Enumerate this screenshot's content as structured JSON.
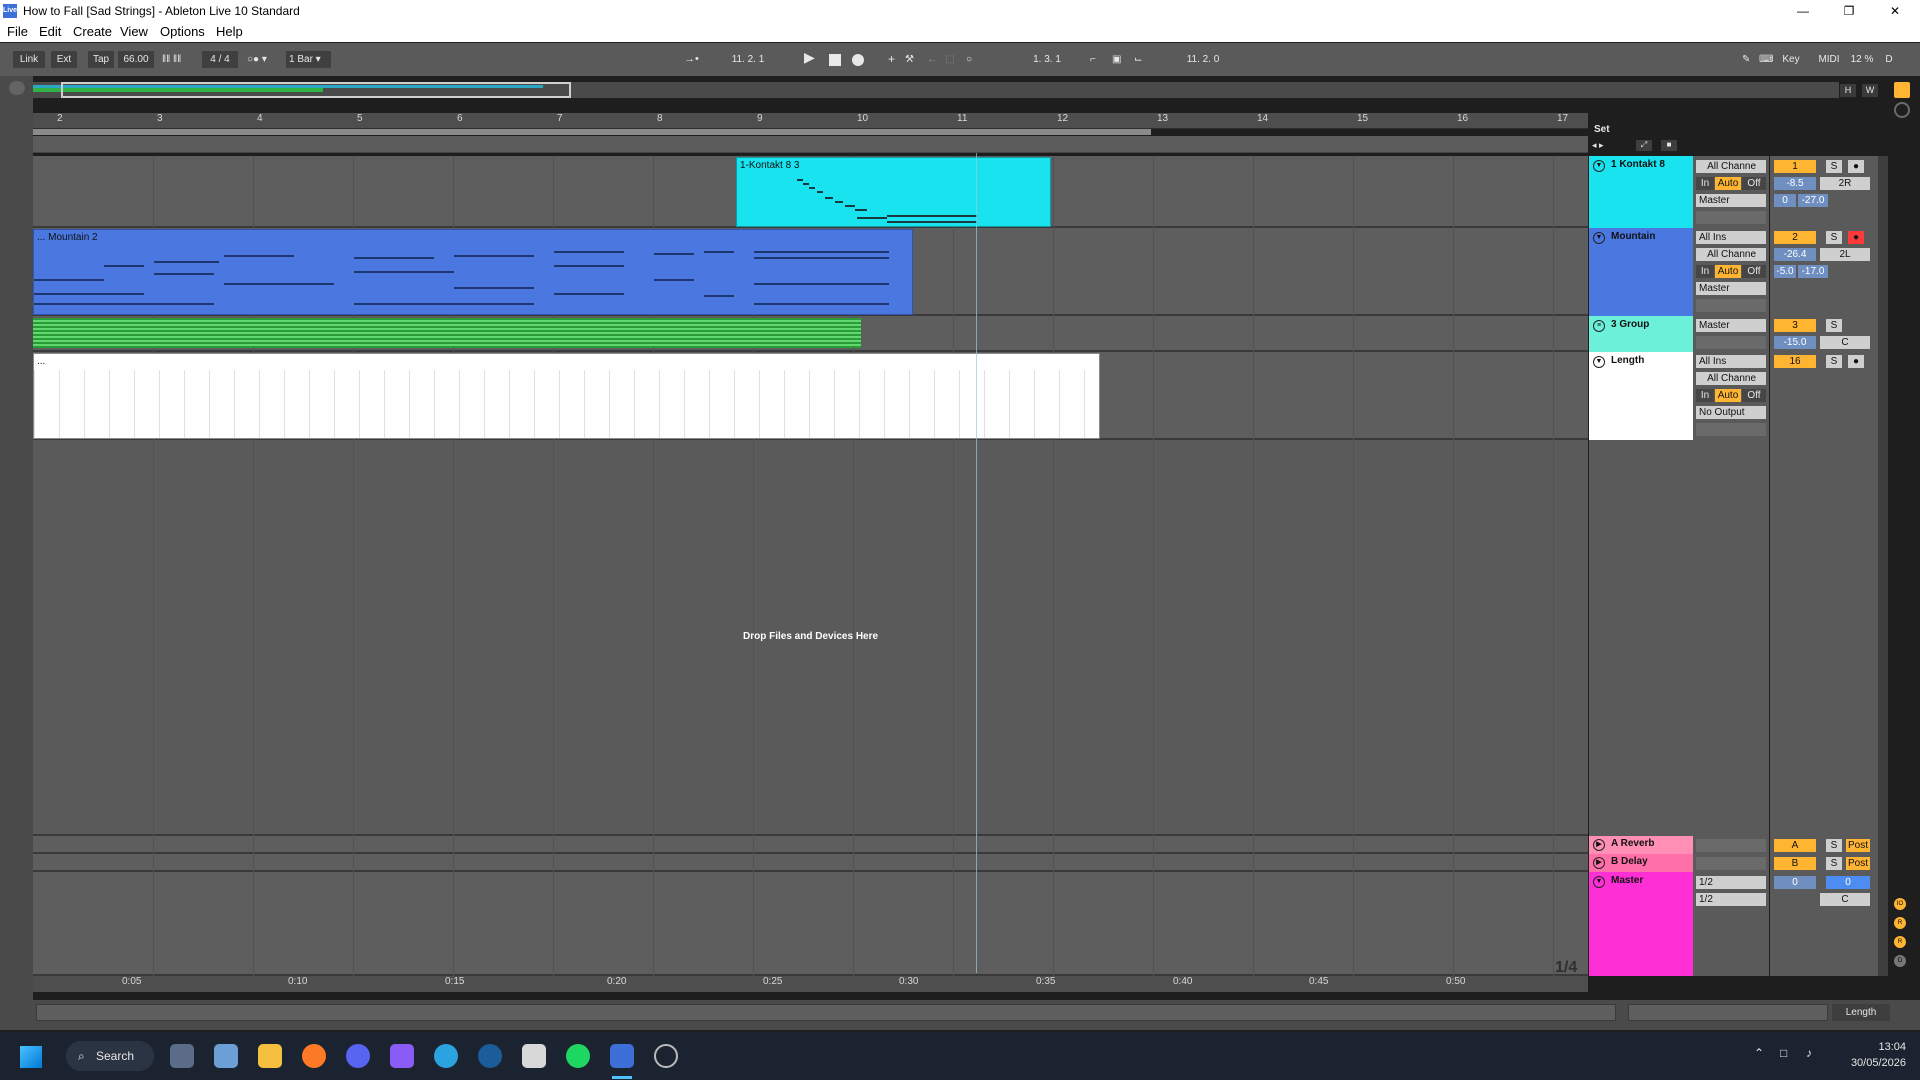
{
  "window": {
    "title": "How to Fall  [Sad Strings] - Ableton Live 10 Standard",
    "app_icon": "Live"
  },
  "menu": [
    "File",
    "Edit",
    "Create",
    "View",
    "Options",
    "Help"
  ],
  "control_bar": {
    "link": "Link",
    "ext": "Ext",
    "tap": "Tap",
    "tempo": "66.00",
    "meter": "4 / 4",
    "quantize": "1 Bar",
    "arrangement_position": "11.  2.  1",
    "loop_start": "1.   3.   1",
    "loop_length": "11.  2.  0",
    "key": "Key",
    "midi": "MIDI",
    "cpu": "12 %",
    "d": "D"
  },
  "overview": {
    "h_label": "H",
    "w_label": "W"
  },
  "ruler": {
    "bars": [
      "2",
      "3",
      "4",
      "5",
      "6",
      "7",
      "8",
      "9",
      "10",
      "11",
      "12",
      "13",
      "14",
      "15",
      "16",
      "17"
    ],
    "set_label": "Set"
  },
  "time_ruler": [
    "0:05",
    "0:10",
    "0:15",
    "0:20",
    "0:25",
    "0:30",
    "0:35",
    "0:40",
    "0:45",
    "0:50"
  ],
  "tracks": [
    {
      "clip_name": "1-Kontakt 8 3",
      "name": "1 Kontakt 8",
      "color": "#19e3ee",
      "input_channel": "All Channe",
      "monitor": [
        "In",
        "Auto",
        "Off"
      ],
      "output": "Master",
      "number": "1",
      "solo": "S",
      "volume": "-8.5",
      "pan": "2R",
      "send_a": "0",
      "send_b": "-27.0"
    },
    {
      "clip_name": "... Mountain 2",
      "name": "Mountain",
      "color": "#4a78e0",
      "input_type": "All Ins",
      "input_channel": "All Channe",
      "monitor": [
        "In",
        "Auto",
        "Off"
      ],
      "output": "Master",
      "number": "2",
      "solo": "S",
      "volume": "-26.4",
      "pan": "2L",
      "send_a": "-5.0",
      "send_b": "-17.0"
    },
    {
      "name": "3 Group",
      "color": "#6cf0da",
      "output": "Master",
      "number": "3",
      "solo": "S",
      "volume": "-15.0",
      "pan": "C"
    },
    {
      "clip_name": "...",
      "name": "Length",
      "color": "#ffffff",
      "input_type": "All Ins",
      "input_channel": "All Channe",
      "monitor": [
        "In",
        "Auto",
        "Off"
      ],
      "output": "No Output",
      "number": "16",
      "solo": "S"
    }
  ],
  "drop_hint": "Drop Files and Devices Here",
  "returns": [
    {
      "name": "A Reverb",
      "color": "#ff8fb4",
      "letter": "A",
      "solo": "S",
      "post": "Post"
    },
    {
      "name": "B Delay",
      "color": "#ff6fa8",
      "letter": "B",
      "solo": "S",
      "post": "Post"
    }
  ],
  "master": {
    "name": "Master",
    "color": "#ff2fd6",
    "cue_out": "1/2",
    "main_out": "1/2",
    "volume": "0",
    "cue_volume": "0",
    "pan": "C"
  },
  "zoom_fraction": "1/4",
  "right_strip": [
    "IO",
    "R",
    "R",
    "D"
  ],
  "status_bar": {
    "right_label": "Length"
  },
  "taskbar": {
    "search": "Search",
    "time": "13:04",
    "date": "30/05/2026",
    "apps": [
      "settings-icon",
      "stocks-icon",
      "file-explorer-icon",
      "firefox-icon",
      "discord-icon",
      "obsidian-icon",
      "telegram-icon",
      "steam-icon",
      "wolf-icon",
      "spotify-icon",
      "ableton-live-icon",
      "obs-icon"
    ]
  }
}
